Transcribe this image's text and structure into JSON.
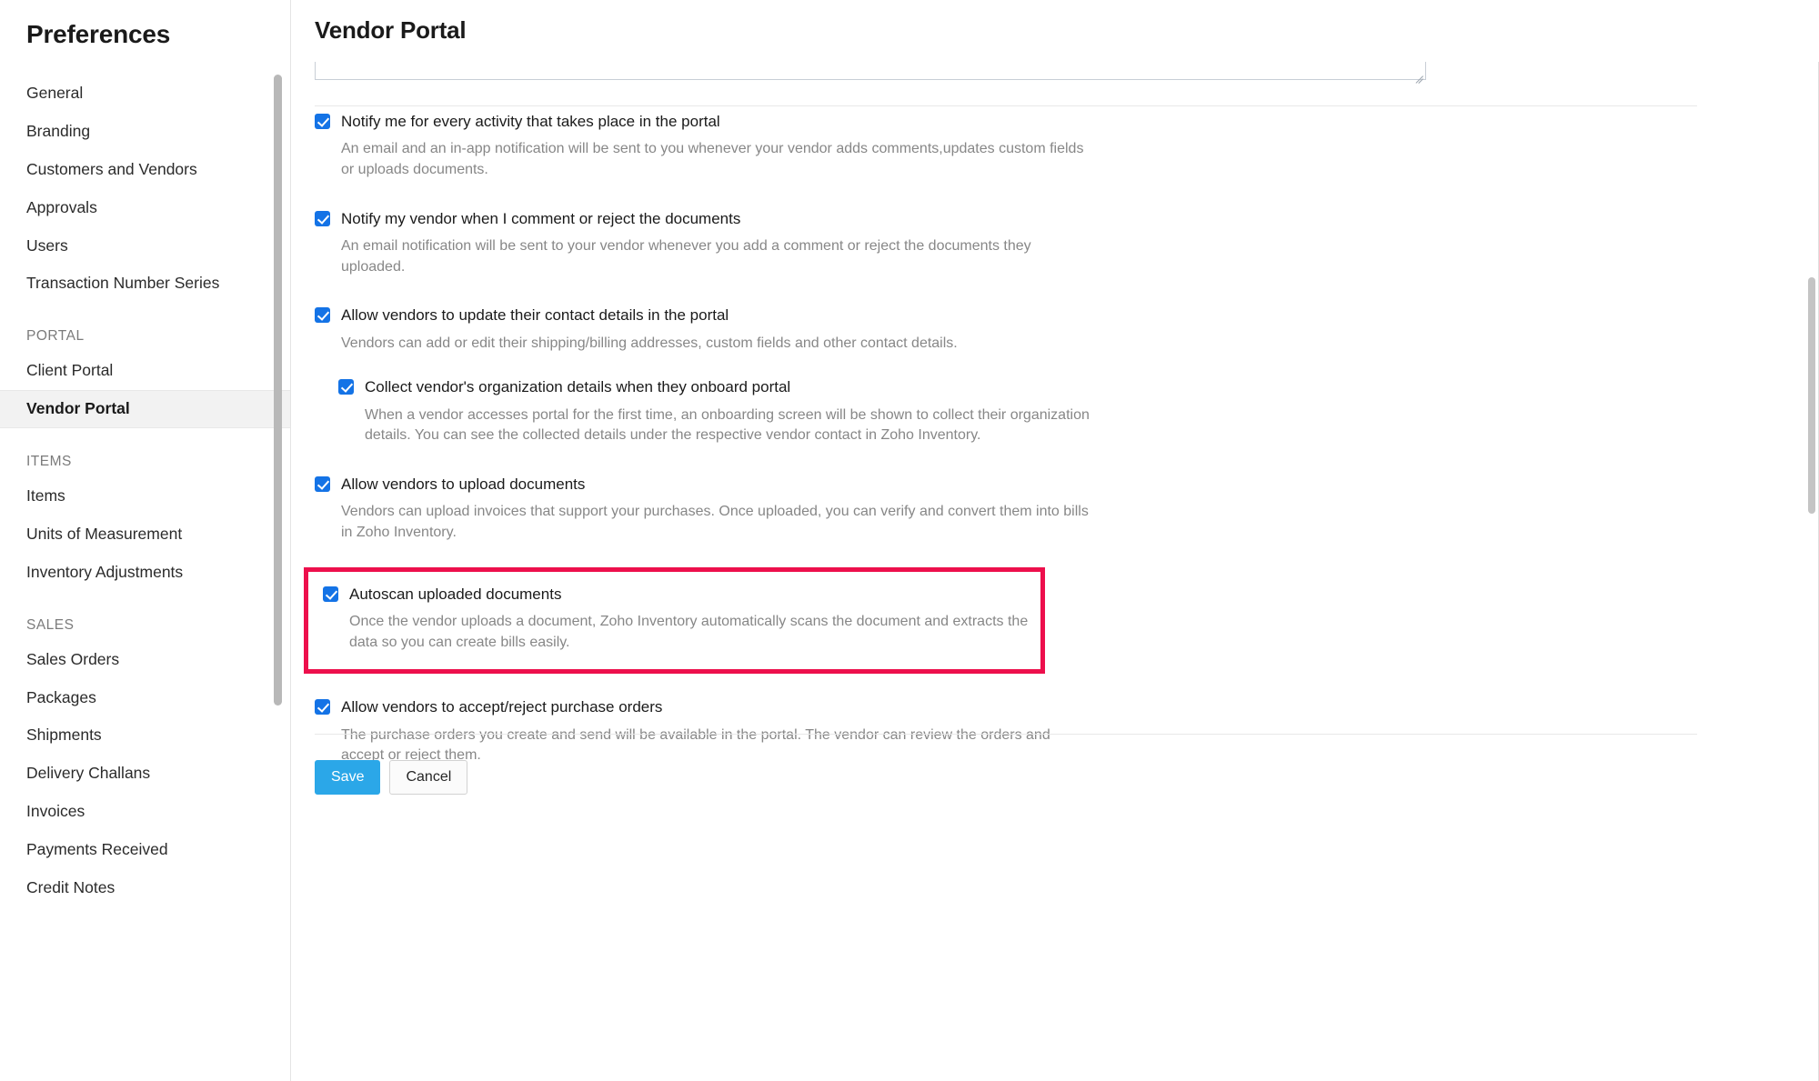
{
  "sidebar": {
    "title": "Preferences",
    "items": [
      {
        "label": "General",
        "type": "item",
        "active": false
      },
      {
        "label": "Branding",
        "type": "item",
        "active": false
      },
      {
        "label": "Customers and Vendors",
        "type": "item",
        "active": false
      },
      {
        "label": "Approvals",
        "type": "item",
        "active": false
      },
      {
        "label": "Users",
        "type": "item",
        "active": false
      },
      {
        "label": "Transaction Number Series",
        "type": "item",
        "active": false
      },
      {
        "label": "PORTAL",
        "type": "section"
      },
      {
        "label": "Client Portal",
        "type": "item",
        "active": false
      },
      {
        "label": "Vendor Portal",
        "type": "item",
        "active": true
      },
      {
        "label": "ITEMS",
        "type": "section"
      },
      {
        "label": "Items",
        "type": "item",
        "active": false
      },
      {
        "label": "Units of Measurement",
        "type": "item",
        "active": false
      },
      {
        "label": "Inventory Adjustments",
        "type": "item",
        "active": false
      },
      {
        "label": "SALES",
        "type": "section"
      },
      {
        "label": "Sales Orders",
        "type": "item",
        "active": false
      },
      {
        "label": "Packages",
        "type": "item",
        "active": false
      },
      {
        "label": "Shipments",
        "type": "item",
        "active": false
      },
      {
        "label": "Delivery Challans",
        "type": "item",
        "active": false
      },
      {
        "label": "Invoices",
        "type": "item",
        "active": false
      },
      {
        "label": "Payments Received",
        "type": "item",
        "active": false
      },
      {
        "label": "Credit Notes",
        "type": "item",
        "active": false
      }
    ]
  },
  "header": {
    "title": "Vendor Portal"
  },
  "options": {
    "notify_activity": {
      "label": "Notify me for every activity that takes place in the portal",
      "description": "An email and an in-app notification will be sent to you whenever your vendor adds comments,updates custom fields or uploads documents.",
      "checked": true
    },
    "notify_vendor_comment": {
      "label": "Notify my vendor when I comment or reject the documents",
      "description": "An email notification will be sent to your vendor whenever you add a comment or reject the documents they uploaded.",
      "checked": true
    },
    "allow_update_contact": {
      "label": "Allow vendors to update their contact details in the portal",
      "description": "Vendors can add or edit their shipping/billing addresses, custom fields and other contact details.",
      "checked": true
    },
    "collect_org_details": {
      "label": "Collect vendor's organization details when they onboard portal",
      "description": "When a vendor accesses portal for the first time, an onboarding screen will be shown to collect their organization details. You can see the collected details under the respective vendor contact in Zoho Inventory.",
      "checked": true
    },
    "allow_upload_documents": {
      "label": "Allow vendors to upload documents",
      "description": "Vendors can upload invoices that support your purchases. Once uploaded, you can verify and convert them into bills in Zoho Inventory.",
      "checked": true
    },
    "autoscan_documents": {
      "label": "Autoscan uploaded documents",
      "description": "Once the vendor uploads a document, Zoho Inventory automatically scans the document and extracts the data so you can create bills easily.",
      "checked": true,
      "highlighted": true
    },
    "allow_accept_reject_po": {
      "label": "Allow vendors to accept/reject purchase orders",
      "description": "The purchase orders you create and send will be available in the portal. The vendor can review the orders and accept or reject them.",
      "checked": true
    }
  },
  "footer": {
    "save_label": "Save",
    "cancel_label": "Cancel"
  },
  "colors": {
    "checkbox_blue": "#1473e6",
    "save_button_blue": "#2ba7e8",
    "highlight_red": "#ed0f4c",
    "active_nav_bg": "#f2f2f2"
  }
}
